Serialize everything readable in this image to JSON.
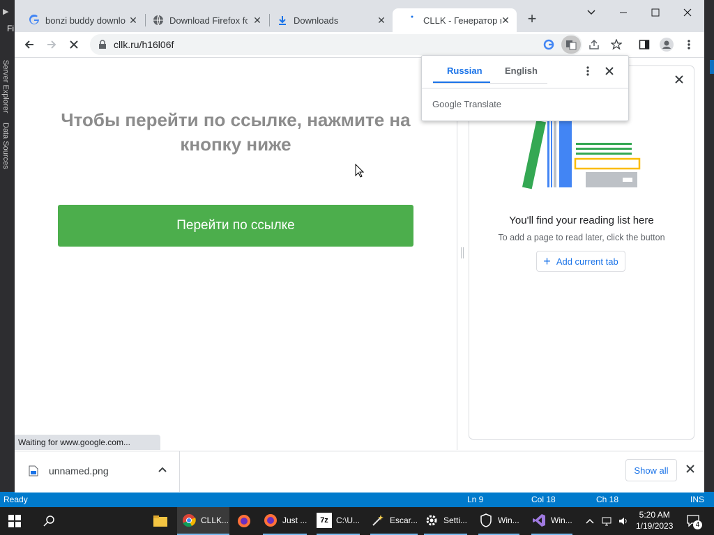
{
  "ide": {
    "left_tabs": [
      "Server Explorer",
      "Data Sources"
    ],
    "menu_fragment": "Fi",
    "status": {
      "ready": "Ready",
      "ln": "Ln 9",
      "col": "Col 18",
      "ch": "Ch 18",
      "ins": "INS"
    }
  },
  "browser": {
    "tabs": [
      {
        "label": "bonzi buddy downlo",
        "icon": "google-g-icon"
      },
      {
        "label": "Download Firefox for",
        "icon": "globe-icon"
      },
      {
        "label": "Downloads",
        "icon": "download-icon"
      },
      {
        "label": "CLLK - Генератор ко",
        "icon": "loading-icon",
        "active": true
      }
    ],
    "url": "cllk.ru/h16l06f"
  },
  "page": {
    "heading": "Чтобы перейти по ссылке, нажмите на кнопку ниже",
    "button": "Перейти по ссылке",
    "status_bubble": "Waiting for www.google.com..."
  },
  "translate": {
    "tab_source": "Russian",
    "tab_target": "English",
    "brand_google": "Google",
    "brand_translate": "Translate"
  },
  "reading_list": {
    "title": "You'll find your reading list here",
    "subtitle": "To add a page to read later, click the button",
    "add_button": "Add current tab"
  },
  "download_shelf": {
    "file": "unnamed.png",
    "show_all": "Show all"
  },
  "taskbar": {
    "items": [
      {
        "label": "CLLK...",
        "icon": "chrome-icon"
      },
      {
        "label": "Just ...",
        "icon": "firefox-icon"
      },
      {
        "label": "C:\\U...",
        "icon": "7zip-icon"
      },
      {
        "label": "Escar...",
        "icon": "wand-icon"
      },
      {
        "label": "Setti...",
        "icon": "settings-gear-icon"
      },
      {
        "label": "Win...",
        "icon": "shield-icon"
      },
      {
        "label": "Win...",
        "icon": "visual-studio-icon"
      }
    ],
    "time": "5:20 AM",
    "date": "1/19/2023",
    "notifications": "4"
  },
  "colors": {
    "accent_blue": "#1a73e8",
    "go_button": "#4cae4c",
    "vs_status": "#007acc"
  }
}
